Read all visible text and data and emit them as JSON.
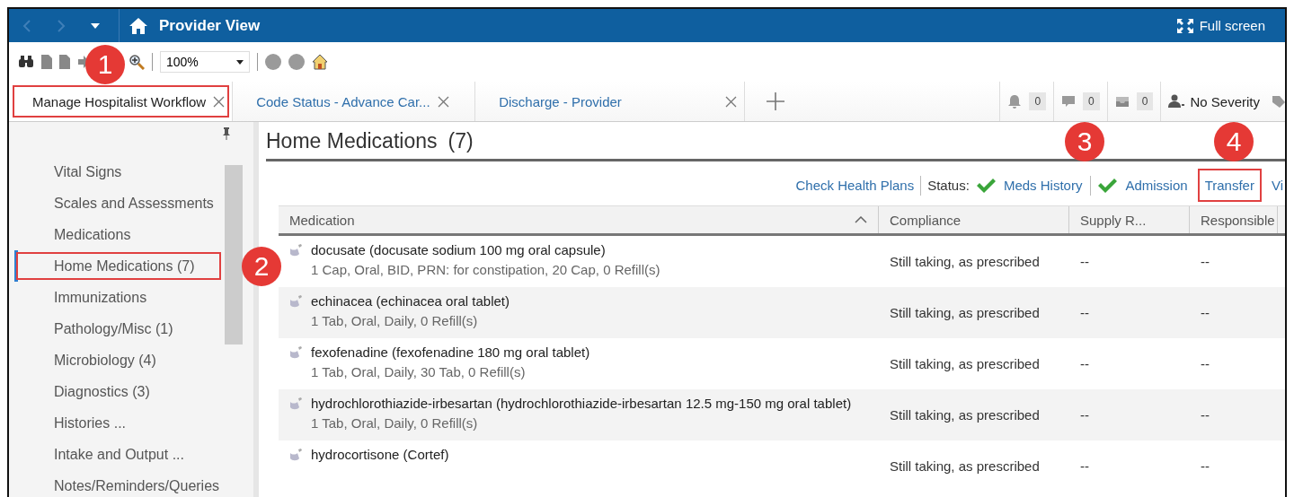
{
  "header": {
    "title": "Provider View",
    "fullscreen": "Full screen"
  },
  "toolbar": {
    "zoom": "100%"
  },
  "tabs": [
    {
      "label": "Manage Hospitalist Workflow",
      "selected": true,
      "highlighted": true
    },
    {
      "label": "Code Status - Advance Car...",
      "selected": false,
      "highlighted": false
    },
    {
      "label": "Discharge - Provider",
      "selected": false,
      "highlighted": false
    }
  ],
  "notifications": [
    {
      "kind": "bell",
      "count": "0"
    },
    {
      "kind": "message",
      "count": "0"
    },
    {
      "kind": "inbox",
      "count": "0"
    }
  ],
  "severity": "No Severity",
  "sidebar": {
    "items": [
      {
        "label": "Vital Signs",
        "selected": false,
        "highlighted": false
      },
      {
        "label": "Scales and Assessments",
        "selected": false,
        "highlighted": false
      },
      {
        "label": "Medications",
        "selected": false,
        "highlighted": false
      },
      {
        "label": "Home Medications (7)",
        "selected": true,
        "highlighted": true
      },
      {
        "label": "Immunizations",
        "selected": false,
        "highlighted": false
      },
      {
        "label": "Pathology/Misc (1)",
        "selected": false,
        "highlighted": false
      },
      {
        "label": "Microbiology (4)",
        "selected": false,
        "highlighted": false
      },
      {
        "label": "Diagnostics (3)",
        "selected": false,
        "highlighted": false
      },
      {
        "label": "Histories ...",
        "selected": false,
        "highlighted": false
      },
      {
        "label": "Intake and Output ...",
        "selected": false,
        "highlighted": false
      },
      {
        "label": "Notes/Reminders/Queries",
        "selected": false,
        "highlighted": false
      }
    ]
  },
  "section": {
    "title": "Home Medications",
    "count": "(7)"
  },
  "status_bar": {
    "link": "Check Health Plans",
    "label": "Status:",
    "items": [
      {
        "label": "Meds History",
        "checked": true,
        "highlighted": false
      },
      {
        "label": "Admission",
        "checked": true,
        "highlighted": false
      },
      {
        "label": "Transfer",
        "checked": false,
        "highlighted": true
      },
      {
        "label": "Vi",
        "checked": false,
        "highlighted": false
      }
    ]
  },
  "table": {
    "columns": [
      {
        "label": "Medication",
        "sorted": true
      },
      {
        "label": "Compliance",
        "sorted": false
      },
      {
        "label": "Supply R...",
        "sorted": false
      },
      {
        "label": "Responsible",
        "sorted": false
      }
    ],
    "rows": [
      {
        "name": "docusate (docusate sodium 100 mg oral capsule)",
        "details": "1 Cap, Oral, BID, PRN: for constipation, 20 Cap, 0 Refill(s)",
        "compliance": "Still taking, as prescribed",
        "supply": "--",
        "responsible": "--"
      },
      {
        "name": "echinacea (echinacea oral tablet)",
        "details": "1 Tab, Oral, Daily, 0 Refill(s)",
        "compliance": "Still taking, as prescribed",
        "supply": "--",
        "responsible": "--"
      },
      {
        "name": "fexofenadine (fexofenadine 180 mg oral tablet)",
        "details": "1 Tab, Oral, Daily, 30 Tab, 0 Refill(s)",
        "compliance": "Still taking, as prescribed",
        "supply": "--",
        "responsible": "--"
      },
      {
        "name": "hydrochlorothiazide-irbesartan (hydrochlorothiazide-irbesartan 12.5 mg-150 mg oral tablet)",
        "details": "1 Tab, Oral, Daily, 0 Refill(s)",
        "compliance": "Still taking, as prescribed",
        "supply": "--",
        "responsible": "--"
      },
      {
        "name": "hydrocortisone (Cortef)",
        "compliance": "Still taking, as prescribed",
        "supply": "--",
        "responsible": "--"
      }
    ]
  },
  "callouts": [
    {
      "number": "1"
    },
    {
      "number": "2"
    },
    {
      "number": "3"
    },
    {
      "number": "4"
    }
  ]
}
